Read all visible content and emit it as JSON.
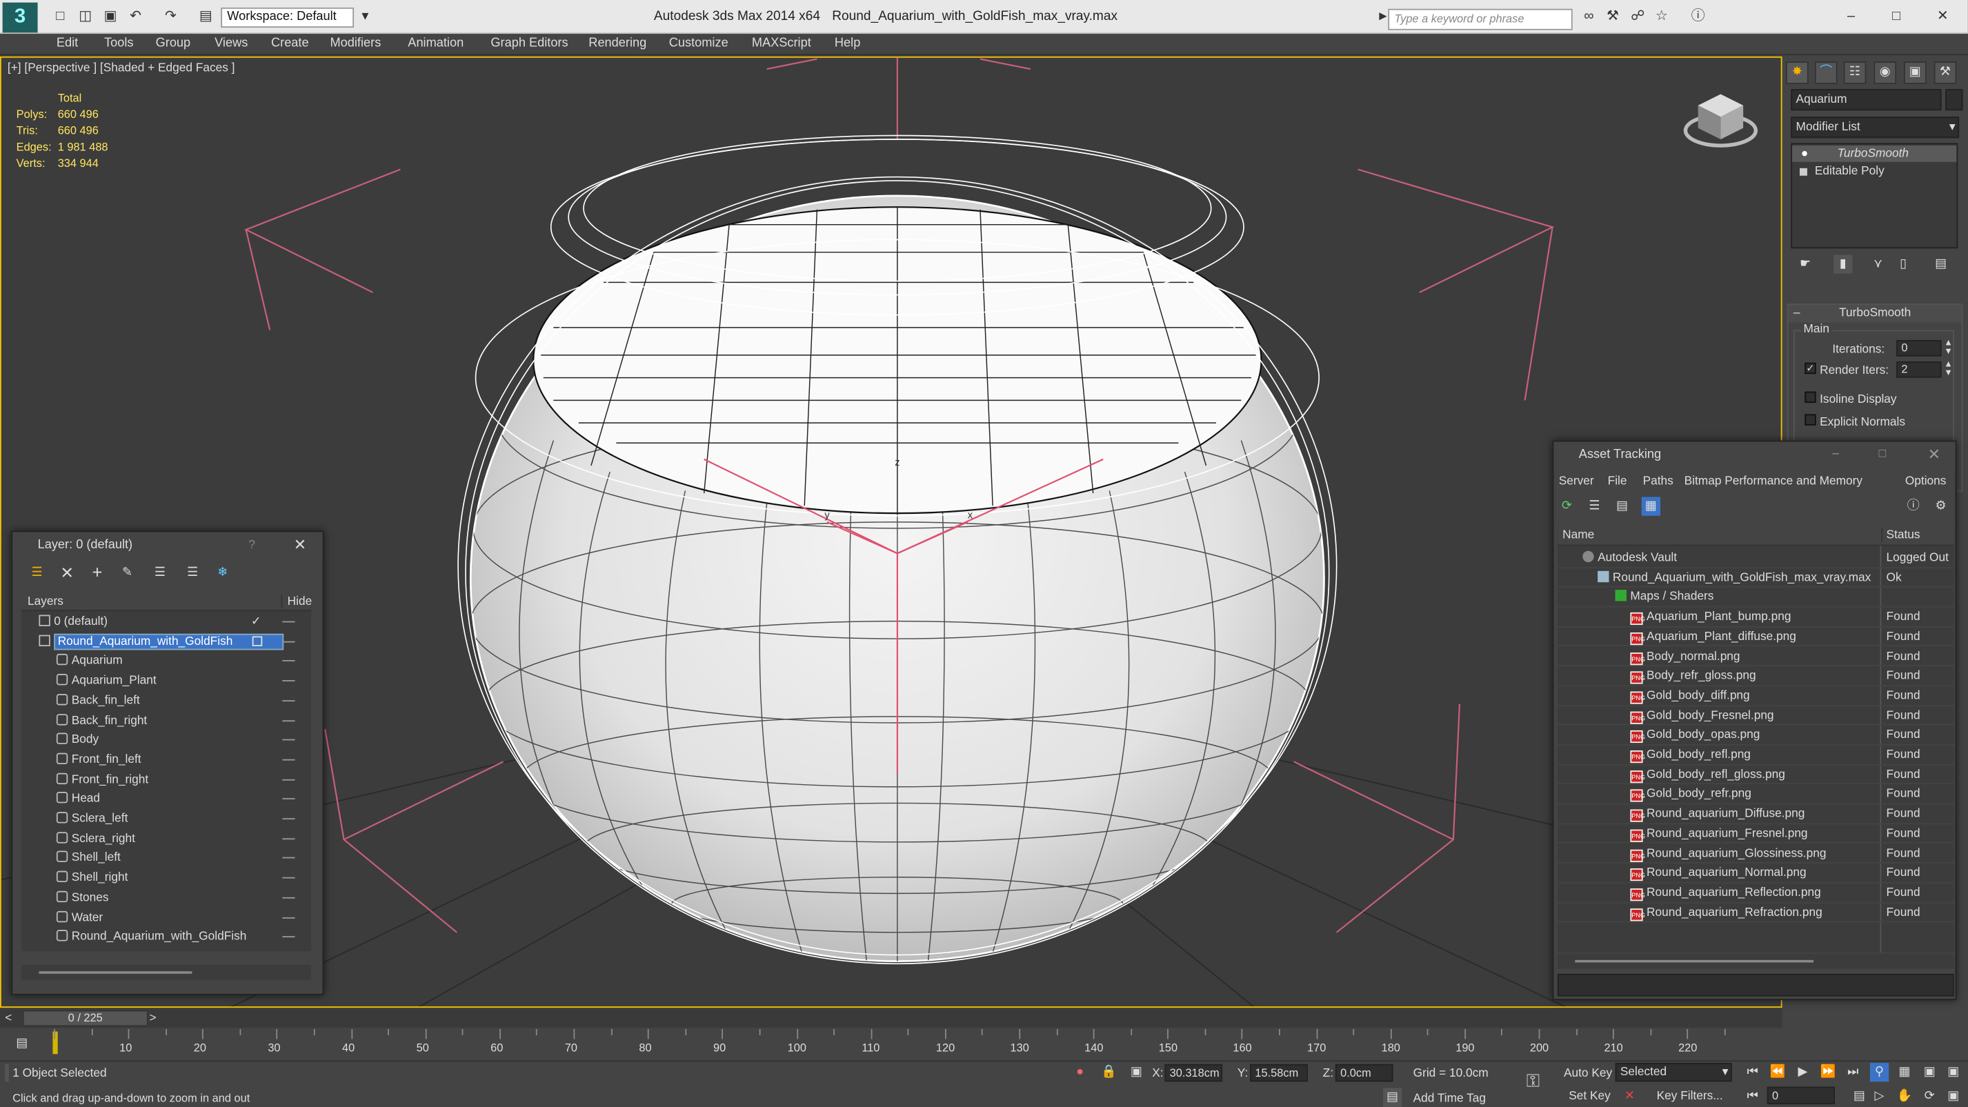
{
  "title": {
    "app": "Autodesk 3ds Max  2014 x64",
    "file": "Round_Aquarium_with_GoldFish_max_vray.max"
  },
  "workspace": {
    "label": "Workspace: Default"
  },
  "search": {
    "placeholder": "Type a keyword or phrase"
  },
  "menu": [
    "Edit",
    "Tools",
    "Group",
    "Views",
    "Create",
    "Modifiers",
    "Animation",
    "Graph Editors",
    "Rendering",
    "Customize",
    "MAXScript",
    "Help"
  ],
  "viewport": {
    "label": "[+] [Perspective ] [Shaded + Edged Faces ]",
    "stats": {
      "header": "Total",
      "polys_label": "Polys:",
      "polys": "660 496",
      "tris_label": "Tris:",
      "tris": "660 496",
      "edges_label": "Edges:",
      "edges": "1 981 488",
      "verts_label": "Verts:",
      "verts": "334 944"
    },
    "axes": {
      "x": "x",
      "y": "y",
      "z": "z"
    }
  },
  "command_panel": {
    "object_name": "Aquarium",
    "modifier_list": "Modifier List",
    "stack": [
      "TurboSmooth",
      "Editable Poly"
    ],
    "rollout_title": "TurboSmooth",
    "group": "Main",
    "iterations_label": "Iterations:",
    "iterations": "0",
    "render_iters_label": "Render Iters:",
    "render_iters": "2",
    "isoline": "Isoline Display",
    "explicit": "Explicit Normals"
  },
  "layer_window": {
    "title": "Layer: 0 (default)",
    "help": "?",
    "col_layers": "Layers",
    "col_hide": "Hide",
    "layers": [
      "0 (default)",
      "Round_Aquarium_with_GoldFish"
    ],
    "objects": [
      "Aquarium",
      "Aquarium_Plant",
      "Back_fin_left",
      "Back_fin_right",
      "Body",
      "Front_fin_left",
      "Front_fin_right",
      "Head",
      "Sclera_left",
      "Sclera_right",
      "Shell_left",
      "Shell_right",
      "Stones",
      "Water",
      "Round_Aquarium_with_GoldFish"
    ]
  },
  "asset_window": {
    "title": "Asset Tracking",
    "menu": [
      "Server",
      "File",
      "Paths",
      "Bitmap Performance and Memory",
      "Options"
    ],
    "col_name": "Name",
    "col_status": "Status",
    "vault": {
      "name": "Autodesk Vault",
      "status": "Logged Out"
    },
    "file": {
      "name": "Round_Aquarium_with_GoldFish_max_vray.max",
      "status": "Ok"
    },
    "maps_label": "Maps / Shaders",
    "png_tag": "PNG",
    "maps": [
      {
        "name": "Aquarium_Plant_bump.png",
        "status": "Found"
      },
      {
        "name": "Aquarium_Plant_diffuse.png",
        "status": "Found"
      },
      {
        "name": "Body_normal.png",
        "status": "Found"
      },
      {
        "name": "Body_refr_gloss.png",
        "status": "Found"
      },
      {
        "name": "Gold_body_diff.png",
        "status": "Found"
      },
      {
        "name": "Gold_body_Fresnel.png",
        "status": "Found"
      },
      {
        "name": "Gold_body_opas.png",
        "status": "Found"
      },
      {
        "name": "Gold_body_refl.png",
        "status": "Found"
      },
      {
        "name": "Gold_body_refl_gloss.png",
        "status": "Found"
      },
      {
        "name": "Gold_body_refr.png",
        "status": "Found"
      },
      {
        "name": "Round_aquarium_Diffuse.png",
        "status": "Found"
      },
      {
        "name": "Round_aquarium_Fresnel.png",
        "status": "Found"
      },
      {
        "name": "Round_aquarium_Glossiness.png",
        "status": "Found"
      },
      {
        "name": "Round_aquarium_Normal.png",
        "status": "Found"
      },
      {
        "name": "Round_aquarium_Reflection.png",
        "status": "Found"
      },
      {
        "name": "Round_aquarium_Refraction.png",
        "status": "Found"
      }
    ]
  },
  "timeline": {
    "frame": "0 / 225",
    "prev": "<",
    "next": ">",
    "ticks": [
      "10",
      "20",
      "30",
      "40",
      "50",
      "60",
      "70",
      "80",
      "90",
      "100",
      "110",
      "120",
      "130",
      "140",
      "150",
      "160",
      "170",
      "180",
      "190",
      "200",
      "210",
      "220"
    ]
  },
  "status": {
    "selection": "1 Object Selected",
    "prompt": "Click and drag up-and-down to zoom in and out",
    "x_label": "X:",
    "x": "30.318cm",
    "y_label": "Y:",
    "y": "15.58cm",
    "z_label": "Z:",
    "z": "0.0cm",
    "grid": "Grid = 10.0cm",
    "add_time_tag": "Add Time Tag",
    "auto_key": "Auto Key",
    "set_key": "Set Key",
    "selected": "Selected",
    "key_filters": "Key Filters...",
    "frame_field": "0"
  }
}
